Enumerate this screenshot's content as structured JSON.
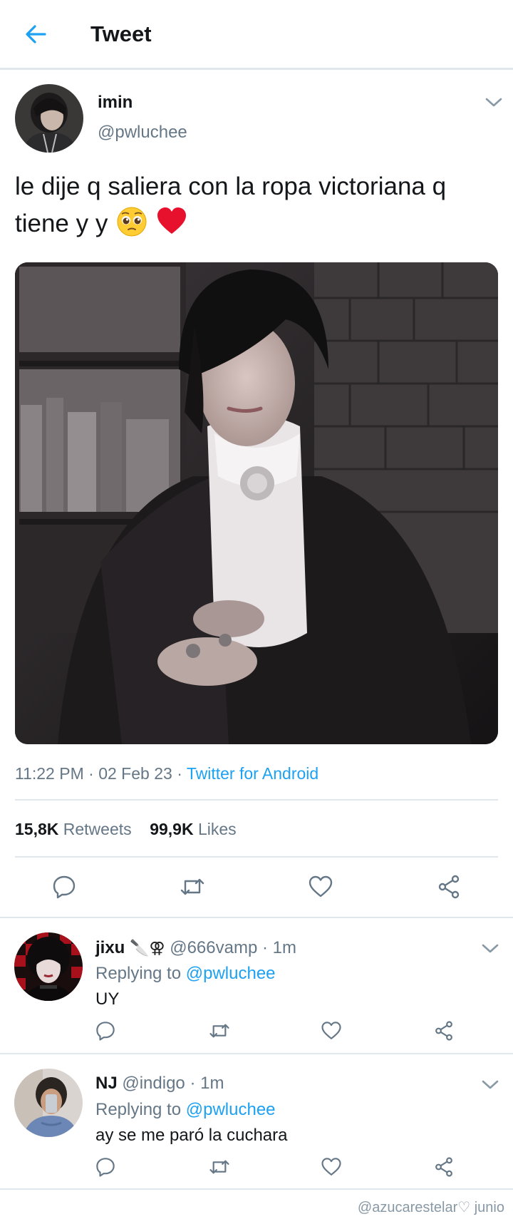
{
  "header": {
    "title": "Tweet",
    "back_icon": "arrow-left-icon"
  },
  "tweet": {
    "author_name": "imin",
    "author_handle": "@pwluchee",
    "text": "le dije q saliera con la ropa victoriana q tiene y y",
    "emojis": [
      "pleading-face-emoji",
      "red-heart-emoji"
    ],
    "time": "11:22 PM",
    "date": "02 Feb 23",
    "separator": "·",
    "source": "Twitter for Android",
    "retweets_count": "15,8K",
    "retweets_label": "Retweets",
    "likes_count": "99,9K",
    "likes_label": "Likes"
  },
  "actions": [
    "reply-icon",
    "retweet-icon",
    "like-icon",
    "share-icon"
  ],
  "replies": [
    {
      "name": "jixu",
      "name_emojis": [
        "knife-emoji",
        "female-symbols-emoji"
      ],
      "handle": "@666vamp",
      "time": "1m",
      "replying_prefix": "Replying to",
      "replying_to": "@pwluchee",
      "text": "UY"
    },
    {
      "name": "NJ",
      "handle": "@indigo",
      "time": "1m",
      "replying_prefix": "Replying to",
      "replying_to": "@pwluchee",
      "text": "ay se me paró la cuchara"
    }
  ],
  "watermark": "@azucarestelar♡ junio",
  "colors": {
    "accent": "#1da1f2",
    "muted": "#657786",
    "text": "#14171a",
    "divider": "#e1e8ed",
    "heart": "#e8112d"
  }
}
